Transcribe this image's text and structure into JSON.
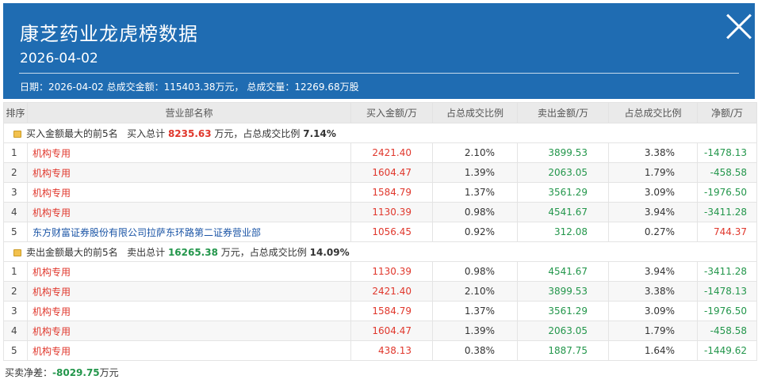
{
  "header": {
    "title": "康芝药业龙虎榜数据",
    "date": "2026-04-02",
    "summary_date_label": "日期：",
    "summary_date": "2026-04-02",
    "turnover_label": "总成交金额：",
    "turnover": "115403.38万元",
    "volume_label": "总成交量：",
    "volume": "12269.68万股"
  },
  "table": {
    "columns": [
      "排序",
      "营业部名称",
      "买入金额/万",
      "占总成交比例",
      "卖出金额/万",
      "占总成交比例",
      "净额/万"
    ],
    "buy_section": {
      "label": "买入金额最大的前5名",
      "total_label": "买入总计",
      "total": "8235.63",
      "total_unit": "万元，占总成交比例",
      "ratio": "7.14%",
      "rows": [
        {
          "rank": "1",
          "name": "机构专用",
          "buy": "2421.40",
          "buy_pct": "2.10%",
          "sell": "3899.53",
          "sell_pct": "3.38%",
          "net": "-1478.13",
          "net_color": "#23964b"
        },
        {
          "rank": "2",
          "name": "机构专用",
          "buy": "1604.47",
          "buy_pct": "1.39%",
          "sell": "2063.05",
          "sell_pct": "1.79%",
          "net": "-458.58",
          "net_color": "#23964b"
        },
        {
          "rank": "3",
          "name": "机构专用",
          "buy": "1584.79",
          "buy_pct": "1.37%",
          "sell": "3561.29",
          "sell_pct": "3.09%",
          "net": "-1976.50",
          "net_color": "#23964b"
        },
        {
          "rank": "4",
          "name": "机构专用",
          "buy": "1130.39",
          "buy_pct": "0.98%",
          "sell": "4541.67",
          "sell_pct": "3.94%",
          "net": "-3411.28",
          "net_color": "#23964b"
        },
        {
          "rank": "5",
          "name": "东方财富证券股份有限公司拉萨东环路第二证券营业部",
          "buy": "1056.45",
          "buy_pct": "0.92%",
          "sell": "312.08",
          "sell_pct": "0.27%",
          "net": "744.37",
          "net_color": "#e0372c"
        }
      ]
    },
    "sell_section": {
      "label": "卖出金额最大的前5名",
      "total_label": "卖出总计",
      "total": "16265.38",
      "total_unit": "万元，占总成交比例",
      "ratio": "14.09%",
      "rows": [
        {
          "rank": "1",
          "name": "机构专用",
          "buy": "1130.39",
          "buy_pct": "0.98%",
          "sell": "4541.67",
          "sell_pct": "3.94%",
          "net": "-3411.28",
          "net_color": "#23964b"
        },
        {
          "rank": "2",
          "name": "机构专用",
          "buy": "2421.40",
          "buy_pct": "2.10%",
          "sell": "3899.53",
          "sell_pct": "3.38%",
          "net": "-1478.13",
          "net_color": "#23964b"
        },
        {
          "rank": "3",
          "name": "机构专用",
          "buy": "1584.79",
          "buy_pct": "1.37%",
          "sell": "3561.29",
          "sell_pct": "3.09%",
          "net": "-1976.50",
          "net_color": "#23964b"
        },
        {
          "rank": "4",
          "name": "机构专用",
          "buy": "1604.47",
          "buy_pct": "1.39%",
          "sell": "2063.05",
          "sell_pct": "1.79%",
          "net": "-458.58",
          "net_color": "#23964b"
        },
        {
          "rank": "5",
          "name": "机构专用",
          "buy": "438.13",
          "buy_pct": "0.38%",
          "sell": "1887.75",
          "sell_pct": "1.64%",
          "net": "-1449.62",
          "net_color": "#23964b"
        }
      ]
    }
  },
  "footer": {
    "label": "买卖净差：",
    "value": "-8029.75",
    "unit": "万元"
  },
  "colors": {
    "header_bg": "#1f6cb2",
    "buy": "#e0372c",
    "sell": "#23964b",
    "branch_link": "#1b55a6"
  },
  "icons": {
    "section": "folder-icon",
    "close": "close-icon"
  }
}
